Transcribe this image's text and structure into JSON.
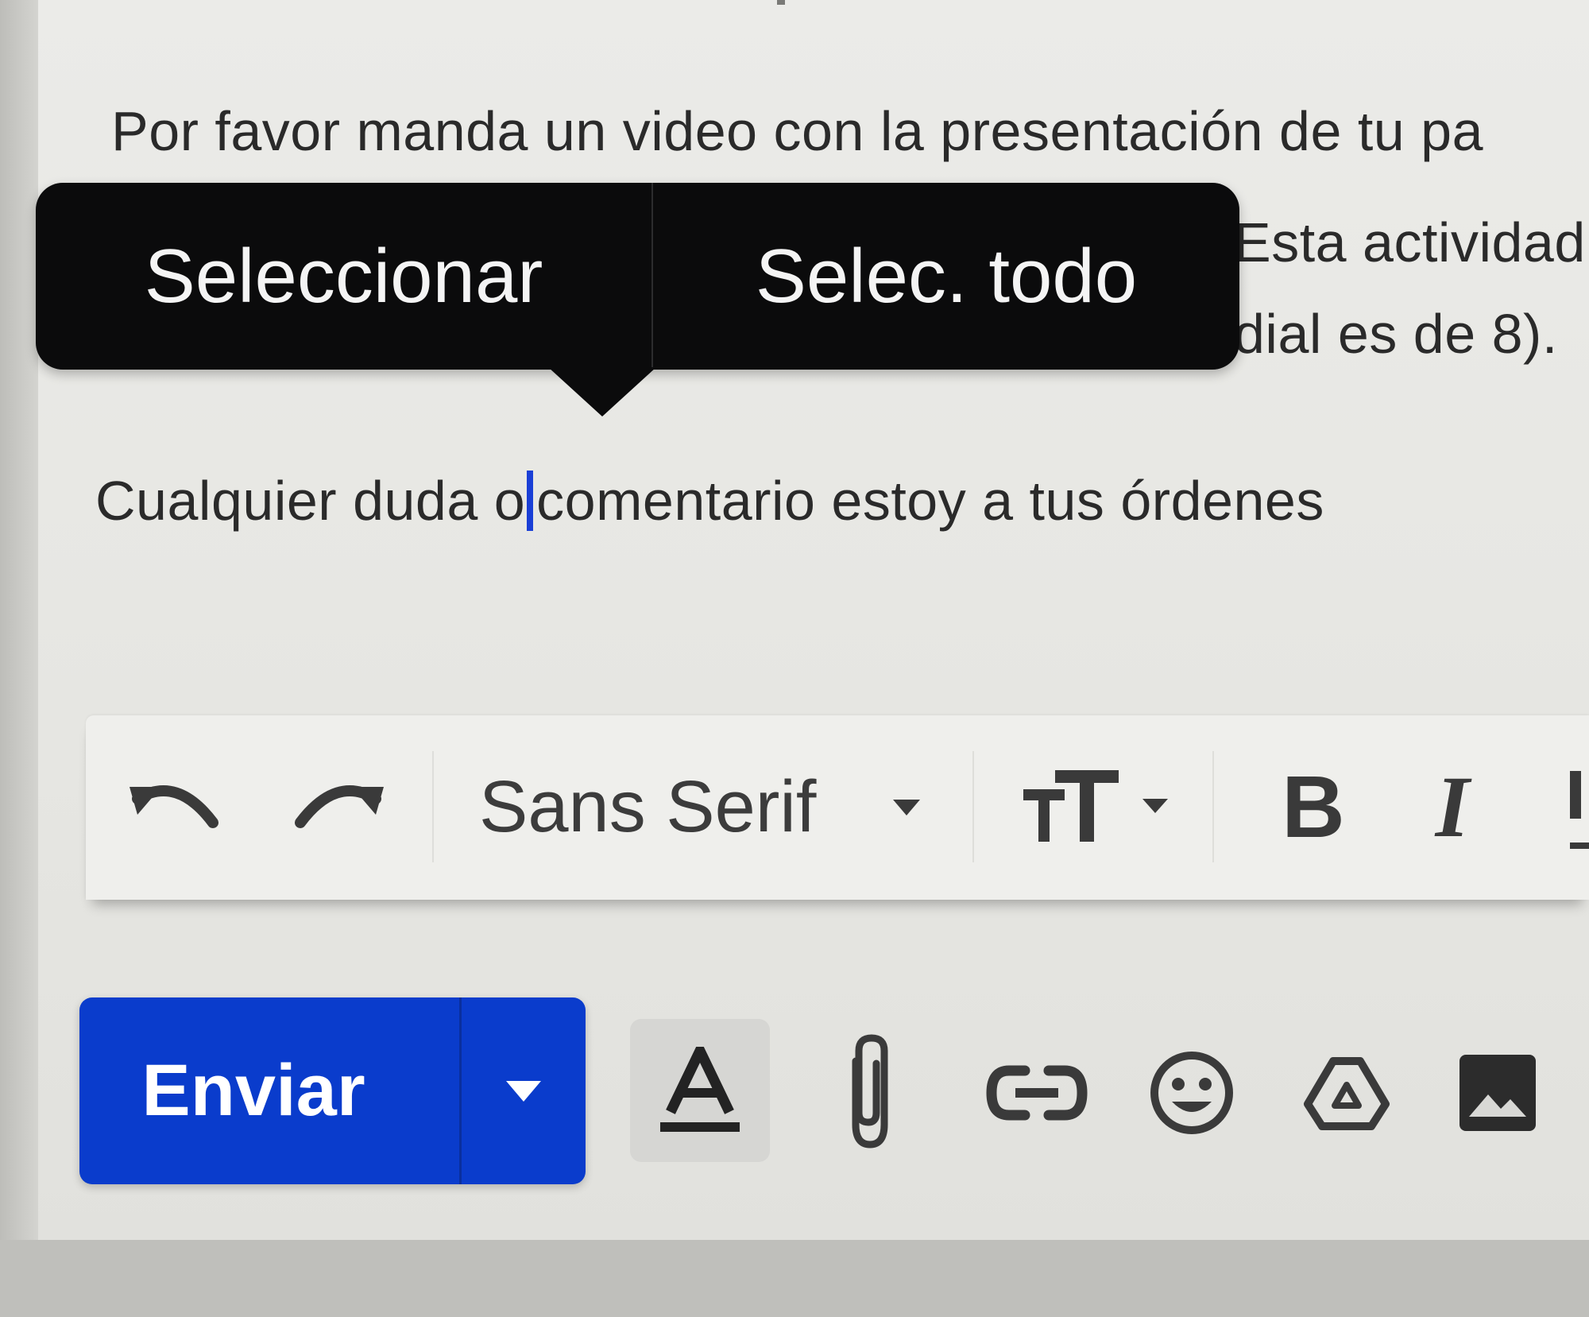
{
  "message_body": {
    "line_1": "Por favor manda un video con la presentación de tu pa",
    "line_2": "Esta actividad",
    "line_3": "dial es de 8).",
    "line_4_before_cursor": "Cualquier duda o",
    "line_4_after_cursor": "comentario estoy a tus órdenes"
  },
  "context_menu": {
    "select_label": "Seleccionar",
    "select_all_label": "Selec. todo"
  },
  "format_toolbar": {
    "undo_icon": "undo-icon",
    "redo_icon": "redo-icon",
    "font_family": "Sans Serif",
    "text_size_icon": "text-size-icon",
    "bold_label": "B",
    "italic_label": "I",
    "underline_icon": "underline-icon"
  },
  "actions": {
    "send_label": "Enviar",
    "send_options_icon": "caret-down-icon",
    "formatting_icon": "text-format-icon",
    "attach_icon": "paperclip-icon",
    "link_icon": "link-icon",
    "emoji_icon": "smiley-icon",
    "drive_icon": "drive-icon",
    "photo_icon": "photo-icon"
  },
  "colors": {
    "send_button": "#0a3ccc",
    "popup_background": "#0b0b0c",
    "cursor": "#1a3fd6"
  }
}
